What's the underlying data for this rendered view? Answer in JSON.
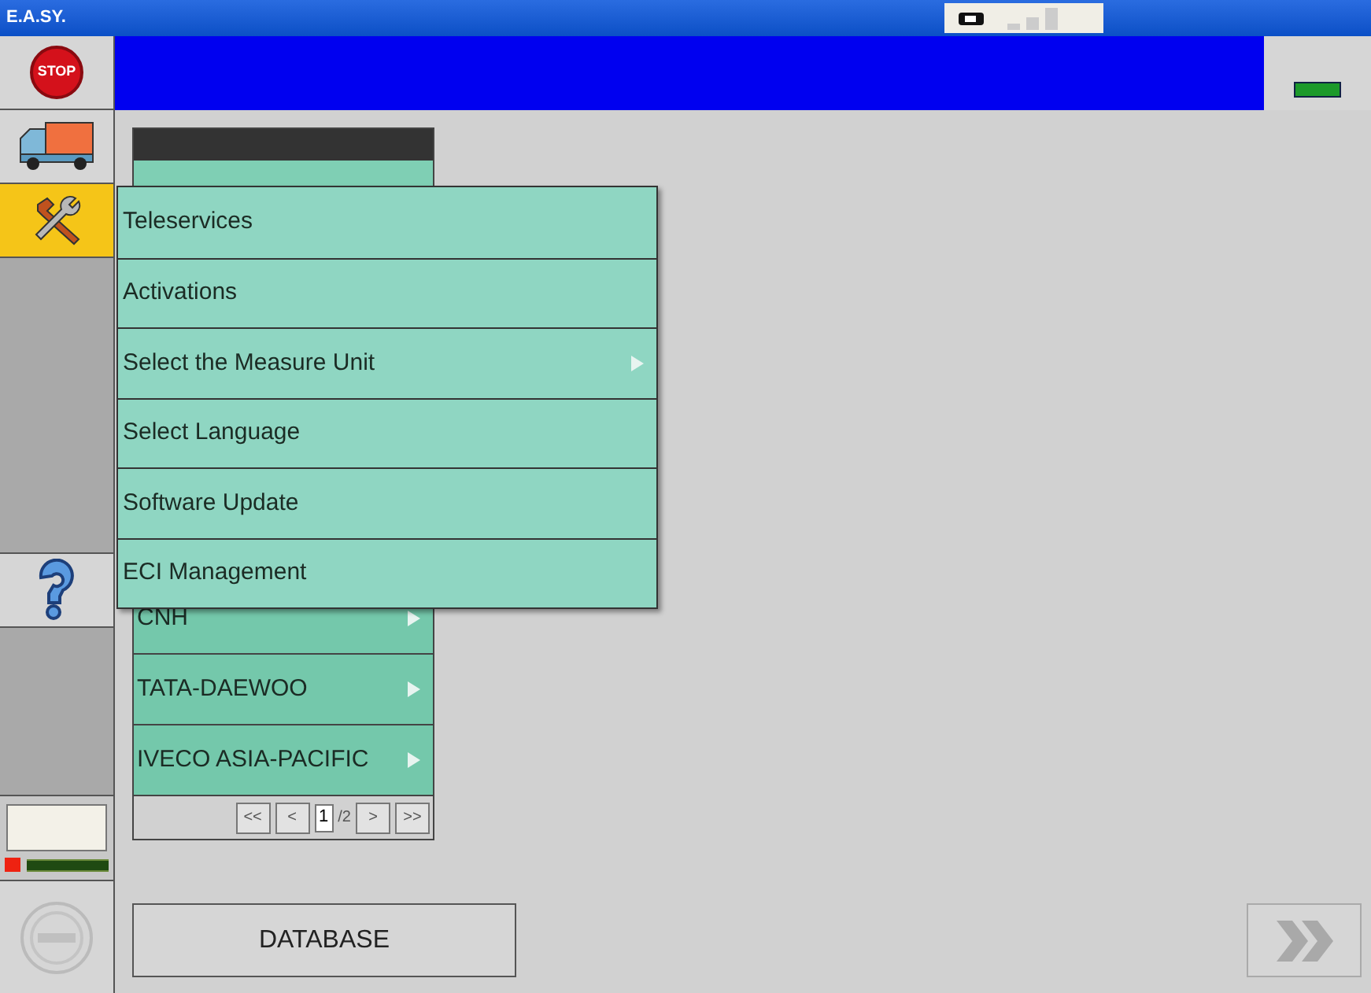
{
  "window": {
    "title": "E.A.SY."
  },
  "sidebar": {
    "items": [
      {
        "kind": "stop",
        "label": "STOP",
        "selected": false
      },
      {
        "kind": "truck",
        "selected": false
      },
      {
        "kind": "tools",
        "selected": true
      },
      {
        "kind": "help",
        "selected": false
      }
    ]
  },
  "menu": {
    "items": [
      {
        "label": "Teleservices",
        "has_submenu": false
      },
      {
        "label": "Activations",
        "has_submenu": false
      },
      {
        "label": "Select the Measure Unit",
        "has_submenu": true
      },
      {
        "label": "Select Language",
        "has_submenu": false
      },
      {
        "label": "Software Update",
        "has_submenu": false
      },
      {
        "label": "ECI Management",
        "has_submenu": false
      }
    ]
  },
  "list": {
    "rows": [
      {
        "label": "CNH"
      },
      {
        "label": "TATA-DAEWOO"
      },
      {
        "label": "IVECO ASIA-PACIFIC"
      }
    ],
    "pager": {
      "first": "<<",
      "prev": "<",
      "page": "1",
      "total": "/2",
      "next": ">",
      "last": ">>"
    }
  },
  "database_button": "DATABASE"
}
